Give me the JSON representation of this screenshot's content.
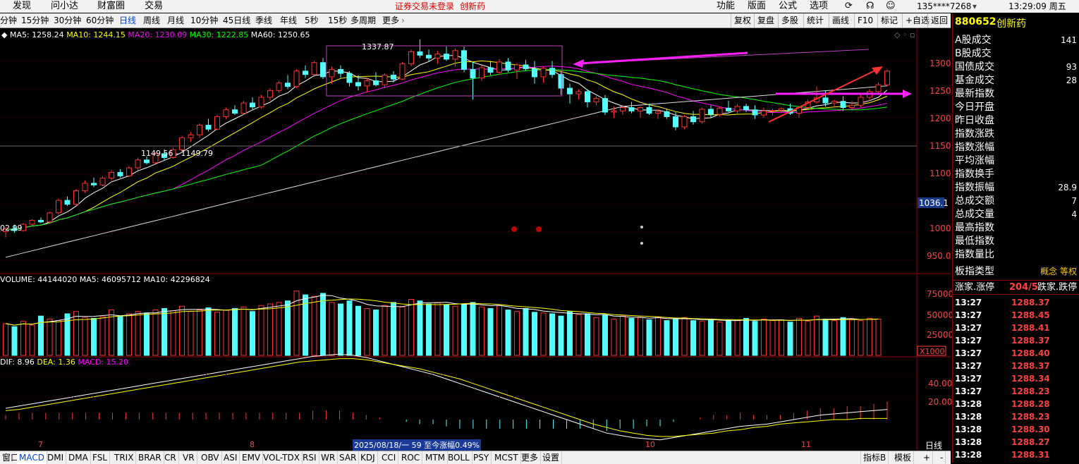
{
  "top_menu": {
    "left_items": [
      "发现",
      "问小达",
      "财富圈",
      "交易"
    ],
    "notice": "证券交易未登录",
    "notice_stock": "创新药",
    "right_items": [
      "功能",
      "版面",
      "公式",
      "选项"
    ],
    "user": "135****7268",
    "clock": "13:29:09 周五"
  },
  "period_bar": {
    "periods": [
      "分钟",
      "15分钟",
      "30分钟",
      "60分钟",
      "日线",
      "周线",
      "月线",
      "10分钟",
      "45日线",
      "季线",
      "年线",
      "5秒",
      "15秒",
      "多周期",
      "更多"
    ],
    "active": "日线",
    "right_buttons": [
      "复权",
      "复盘",
      "多股",
      "统计",
      "画线",
      "F10",
      "标记",
      "+自选",
      "返回"
    ]
  },
  "main_chart": {
    "ma_legend": [
      {
        "label": "MA5: 1258.24",
        "color": "#ffffff"
      },
      {
        "label": "MA10: 1244.15",
        "color": "#ffff00"
      },
      {
        "label": "MA20: 1230.09",
        "color": "#ff00ff"
      },
      {
        "label": "MA30: 1222.85",
        "color": "#00ff00"
      },
      {
        "label": "MA60: 1250.65",
        "color": "#ffffff"
      }
    ],
    "y_ticks": [
      "1300",
      "1250",
      "1200",
      "1150",
      "1100",
      "1050",
      "1000",
      "950.0"
    ],
    "current_tag": "1036.1",
    "high_label": "1337.87",
    "low_label": "02.99",
    "hline_label": "1149.56 - 1149.79",
    "x_labels": [
      "7",
      "8",
      "9",
      "10",
      "11"
    ],
    "x_tip": "2025/08/18/一 59 至今涨幅0.49%",
    "x_tip_right": "日线"
  },
  "volume_chart": {
    "legend": [
      {
        "label": "VOLUME: 44144020",
        "color": "#ffffff"
      },
      {
        "label": "MA5: 46095712",
        "color": "#ffffff"
      },
      {
        "label": "MA10: 42296824",
        "color": "#ffffff"
      }
    ],
    "y_ticks": [
      "75000",
      "50000",
      "25000"
    ],
    "unit": "X1000"
  },
  "macd_chart": {
    "legend": [
      {
        "label": "DIF: 8.96",
        "color": "#ffffff"
      },
      {
        "label": "DEA: 1.36",
        "color": "#ffff00"
      },
      {
        "label": "MACD: 15.20",
        "color": "#ff00ff"
      }
    ],
    "y_ticks": [
      "40.00",
      "20.00"
    ]
  },
  "right_panel": {
    "code": "880652",
    "name": "创新药",
    "rows": [
      {
        "label": "A股成交",
        "value": "141"
      },
      {
        "label": "B股成交",
        "value": ""
      },
      {
        "label": "国债成交",
        "value": "93"
      },
      {
        "label": "基金成交",
        "value": "28"
      },
      {
        "label": "最新指数",
        "value": ""
      },
      {
        "label": "今日开盘",
        "value": ""
      },
      {
        "label": "昨日收盘",
        "value": ""
      },
      {
        "label": "指数涨跌",
        "value": ""
      },
      {
        "label": "指数涨幅",
        "value": ""
      },
      {
        "label": "平均涨幅",
        "value": ""
      },
      {
        "label": "指数换手",
        "value": ""
      },
      {
        "label": "指数振幅",
        "value": "28.9"
      },
      {
        "label": "总成交额",
        "value": "7"
      },
      {
        "label": "总成交量",
        "value": "4"
      },
      {
        "label": "最高指数",
        "value": ""
      },
      {
        "label": "最低指数",
        "value": ""
      },
      {
        "label": "指数量比",
        "value": ""
      }
    ],
    "type_label": "板指类型",
    "type_value": "概念 等权",
    "up_label": "涨家.涨停",
    "up_value": "204/5",
    "down_label": "跌家.跌停",
    "ticks": [
      {
        "time": "13:27",
        "price": "1288.37"
      },
      {
        "time": "13:27",
        "price": "1288.45"
      },
      {
        "time": "13:27",
        "price": "1288.41"
      },
      {
        "time": "13:27",
        "price": "1288.37"
      },
      {
        "time": "13:27",
        "price": "1288.40"
      },
      {
        "time": "13:27",
        "price": "1288.37"
      },
      {
        "time": "13:27",
        "price": "1288.34"
      },
      {
        "time": "13:27",
        "price": "1288.23"
      },
      {
        "time": "13:28",
        "price": "1288.28"
      },
      {
        "time": "13:28",
        "price": "1288.23"
      },
      {
        "time": "13:28",
        "price": "1288.30"
      },
      {
        "time": "13:28",
        "price": "1288.27"
      },
      {
        "time": "13:28",
        "price": "1288.31"
      }
    ]
  },
  "indicator_bar": {
    "items": [
      "窗口",
      "MACD",
      "DMI",
      "DMA",
      "FSL",
      "TRIX",
      "BRAR",
      "CR",
      "VR",
      "OBV",
      "ASI",
      "EMV",
      "VOL-TDX",
      "RSI",
      "WR",
      "SAR",
      "KDJ",
      "CCI",
      "ROC",
      "MTM",
      "BOLL",
      "PSY",
      "MCST",
      "更多",
      "设置"
    ],
    "active": "MACD",
    "right_items": [
      "指标B",
      "模板",
      "+",
      "-"
    ]
  },
  "chart_data": {
    "type": "candlestick",
    "ylim": [
      930,
      1345
    ],
    "candles": [
      [
        1000,
        1008,
        990,
        1005
      ],
      [
        1005,
        1012,
        998,
        1002
      ],
      [
        1002,
        1015,
        1000,
        1013
      ],
      [
        1013,
        1022,
        1010,
        1020
      ],
      [
        1020,
        1025,
        1015,
        1017
      ],
      [
        1017,
        1035,
        1015,
        1033
      ],
      [
        1033,
        1058,
        1030,
        1055
      ],
      [
        1055,
        1062,
        1045,
        1048
      ],
      [
        1048,
        1075,
        1045,
        1072
      ],
      [
        1072,
        1090,
        1068,
        1085
      ],
      [
        1085,
        1095,
        1078,
        1082
      ],
      [
        1082,
        1098,
        1080,
        1094
      ],
      [
        1094,
        1108,
        1090,
        1104
      ],
      [
        1104,
        1110,
        1095,
        1098
      ],
      [
        1098,
        1115,
        1096,
        1112
      ],
      [
        1112,
        1130,
        1108,
        1126
      ],
      [
        1126,
        1132,
        1118,
        1121
      ],
      [
        1121,
        1140,
        1119,
        1137
      ],
      [
        1137,
        1145,
        1125,
        1130
      ],
      [
        1130,
        1148,
        1128,
        1144
      ],
      [
        1144,
        1168,
        1140,
        1165
      ],
      [
        1165,
        1175,
        1158,
        1170
      ],
      [
        1170,
        1190,
        1165,
        1187
      ],
      [
        1187,
        1198,
        1176,
        1180
      ],
      [
        1180,
        1205,
        1178,
        1202
      ],
      [
        1202,
        1218,
        1198,
        1214
      ],
      [
        1214,
        1222,
        1205,
        1208
      ],
      [
        1208,
        1230,
        1205,
        1226
      ],
      [
        1226,
        1236,
        1215,
        1219
      ],
      [
        1219,
        1240,
        1216,
        1236
      ],
      [
        1236,
        1252,
        1230,
        1248
      ],
      [
        1248,
        1265,
        1244,
        1261
      ],
      [
        1261,
        1275,
        1250,
        1255
      ],
      [
        1255,
        1285,
        1252,
        1282
      ],
      [
        1282,
        1292,
        1270,
        1276
      ],
      [
        1276,
        1300,
        1272,
        1297
      ],
      [
        1297,
        1305,
        1268,
        1272
      ],
      [
        1272,
        1290,
        1260,
        1285
      ],
      [
        1285,
        1292,
        1270,
        1278
      ],
      [
        1278,
        1282,
        1255,
        1262
      ],
      [
        1262,
        1275,
        1248,
        1256
      ],
      [
        1256,
        1270,
        1245,
        1265
      ],
      [
        1265,
        1280,
        1255,
        1258
      ],
      [
        1258,
        1278,
        1252,
        1275
      ],
      [
        1275,
        1282,
        1262,
        1268
      ],
      [
        1268,
        1298,
        1266,
        1295
      ],
      [
        1295,
        1320,
        1290,
        1316
      ],
      [
        1316,
        1338,
        1305,
        1310
      ],
      [
        1310,
        1320,
        1298,
        1305
      ],
      [
        1305,
        1318,
        1295,
        1312
      ],
      [
        1312,
        1325,
        1300,
        1303
      ],
      [
        1303,
        1322,
        1290,
        1318
      ],
      [
        1318,
        1325,
        1280,
        1285
      ],
      [
        1285,
        1298,
        1232,
        1270
      ],
      [
        1270,
        1292,
        1265,
        1288
      ],
      [
        1288,
        1300,
        1275,
        1280
      ],
      [
        1280,
        1303,
        1276,
        1298
      ],
      [
        1298,
        1305,
        1280,
        1284
      ],
      [
        1284,
        1296,
        1268,
        1293
      ],
      [
        1293,
        1302,
        1282,
        1286
      ],
      [
        1286,
        1300,
        1260,
        1272
      ],
      [
        1272,
        1290,
        1262,
        1287
      ],
      [
        1287,
        1300,
        1270,
        1276
      ],
      [
        1276,
        1282,
        1240,
        1252
      ],
      [
        1252,
        1260,
        1225,
        1242
      ],
      [
        1242,
        1250,
        1232,
        1246
      ],
      [
        1246,
        1250,
        1218,
        1228
      ],
      [
        1228,
        1238,
        1222,
        1234
      ],
      [
        1234,
        1240,
        1205,
        1210
      ],
      [
        1210,
        1220,
        1200,
        1212
      ],
      [
        1212,
        1222,
        1205,
        1218
      ],
      [
        1218,
        1228,
        1208,
        1212
      ],
      [
        1212,
        1220,
        1200,
        1218
      ],
      [
        1218,
        1225,
        1205,
        1208
      ],
      [
        1208,
        1215,
        1198,
        1211
      ],
      [
        1211,
        1216,
        1198,
        1202
      ],
      [
        1202,
        1210,
        1178,
        1184
      ],
      [
        1184,
        1205,
        1180,
        1202
      ],
      [
        1202,
        1212,
        1188,
        1193
      ],
      [
        1193,
        1218,
        1190,
        1215
      ],
      [
        1215,
        1222,
        1200,
        1206
      ],
      [
        1206,
        1220,
        1202,
        1217
      ],
      [
        1217,
        1230,
        1210,
        1212
      ],
      [
        1212,
        1224,
        1205,
        1220
      ],
      [
        1220,
        1225,
        1210,
        1214
      ],
      [
        1214,
        1222,
        1198,
        1205
      ],
      [
        1205,
        1218,
        1200,
        1212
      ],
      [
        1212,
        1216,
        1204,
        1213
      ],
      [
        1213,
        1218,
        1208,
        1216
      ],
      [
        1216,
        1225,
        1205,
        1208
      ],
      [
        1208,
        1220,
        1200,
        1218
      ],
      [
        1218,
        1232,
        1215,
        1228
      ],
      [
        1228,
        1255,
        1225,
        1235
      ],
      [
        1235,
        1248,
        1220,
        1226
      ],
      [
        1226,
        1232,
        1218,
        1229
      ],
      [
        1229,
        1238,
        1212,
        1218
      ],
      [
        1218,
        1230,
        1215,
        1222
      ],
      [
        1222,
        1240,
        1218,
        1236
      ],
      [
        1236,
        1250,
        1230,
        1246
      ],
      [
        1246,
        1262,
        1240,
        1258
      ],
      [
        1258,
        1285,
        1255,
        1282
      ]
    ],
    "volume": [
      42,
      38,
      45,
      40,
      52,
      48,
      46,
      55,
      58,
      50,
      49,
      51,
      60,
      52,
      55,
      58,
      56,
      60,
      62,
      59,
      65,
      58,
      60,
      63,
      57,
      60,
      62,
      64,
      58,
      66,
      68,
      70,
      72,
      85,
      80,
      78,
      82,
      70,
      68,
      72,
      65,
      62,
      60,
      66,
      70,
      64,
      74,
      72,
      68,
      70,
      67,
      65,
      68,
      70,
      64,
      62,
      66,
      60,
      58,
      62,
      57,
      56,
      55,
      52,
      58,
      54,
      55,
      50,
      53,
      48,
      52,
      49,
      50,
      47,
      51,
      46,
      48,
      50,
      46,
      45,
      48,
      44,
      47,
      46,
      49,
      45,
      48,
      46,
      47,
      44,
      49,
      45,
      52,
      48,
      46,
      50,
      47,
      46,
      49,
      48
    ],
    "dif": [
      10,
      12,
      14,
      16,
      18,
      20,
      22,
      24,
      26,
      28,
      30,
      32,
      34,
      36,
      38,
      40,
      42,
      44,
      46,
      48,
      50,
      52,
      54,
      56,
      57,
      58,
      57,
      55,
      52,
      49,
      46,
      43,
      40,
      36,
      32,
      28,
      24,
      20,
      16,
      12,
      8,
      4,
      0,
      -4,
      -8,
      -12,
      -14,
      -16,
      -17,
      -18,
      -16,
      -14,
      -12,
      -10,
      -8,
      -6,
      -5,
      -4,
      -2,
      0,
      2,
      4,
      5,
      6,
      7,
      8,
      9
    ],
    "dea": [
      8,
      9,
      11,
      13,
      15,
      17,
      19,
      21,
      23,
      25,
      27,
      29,
      31,
      33,
      35,
      37,
      39,
      41,
      43,
      45,
      47,
      49,
      51,
      52,
      53,
      54,
      54,
      53,
      51,
      49,
      47,
      45,
      42,
      39,
      36,
      32,
      28,
      24,
      20,
      16,
      12,
      8,
      4,
      0,
      -4,
      -7,
      -10,
      -12,
      -14,
      -15,
      -15,
      -14,
      -13,
      -12,
      -10,
      -9,
      -7,
      -6,
      -4,
      -3,
      -2,
      -1,
      0,
      0,
      1,
      1,
      1
    ]
  }
}
